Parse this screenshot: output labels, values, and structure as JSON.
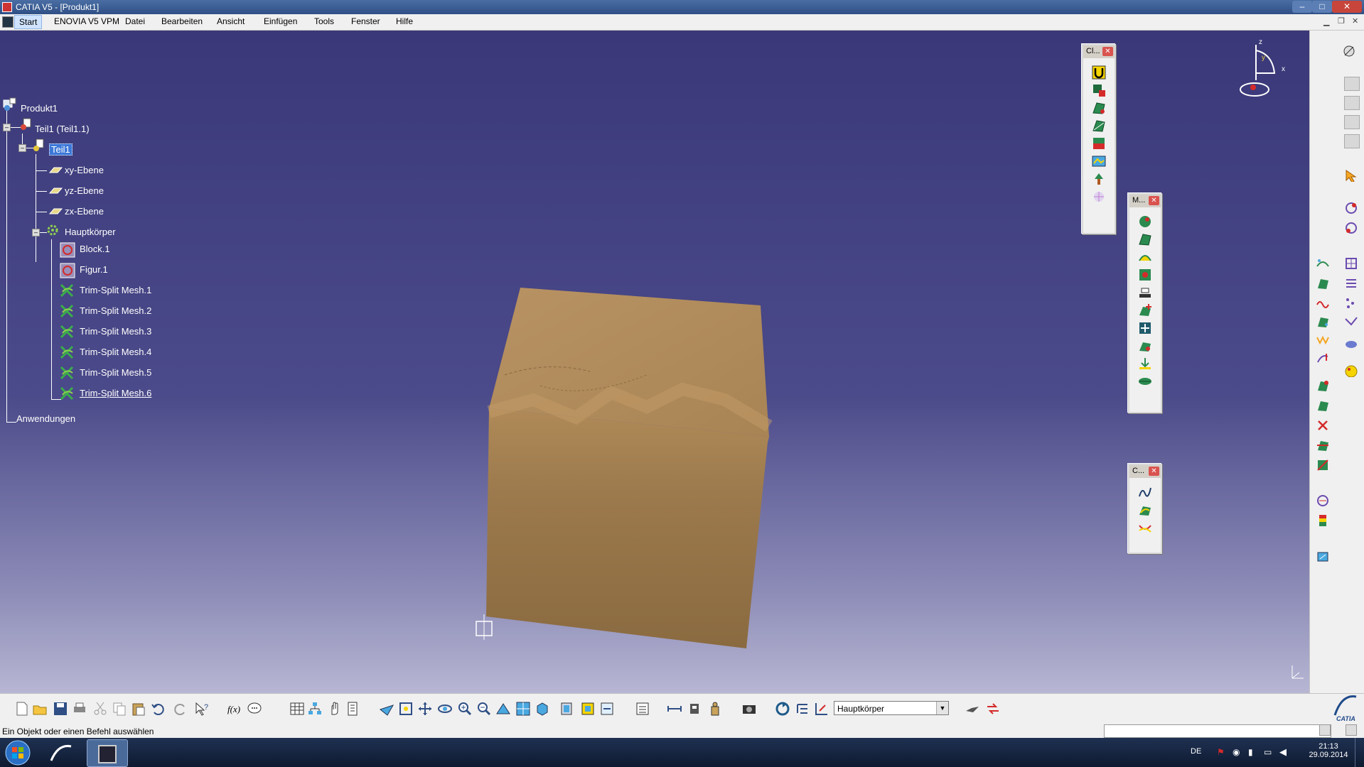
{
  "window": {
    "title": "CATIA V5 - [Produkt1]",
    "controls": [
      "–",
      "□",
      "✕"
    ]
  },
  "menubar": {
    "items": [
      "Start",
      "ENOVIA V5 VPM",
      "Datei",
      "Bearbeiten",
      "Ansicht",
      "Einfügen",
      "Tools",
      "Fenster",
      "Hilfe"
    ]
  },
  "tree": {
    "root": "Produkt1",
    "part_instance": "Teil1 (Teil1.1)",
    "part": "Teil1",
    "planes": [
      "xy-Ebene",
      "yz-Ebene",
      "zx-Ebene"
    ],
    "body": "Hauptkörper",
    "features": [
      "Block.1",
      "Figur.1",
      "Trim-Split Mesh.1",
      "Trim-Split Mesh.2",
      "Trim-Split Mesh.3",
      "Trim-Split Mesh.4",
      "Trim-Split Mesh.5",
      "Trim-Split Mesh.6"
    ],
    "applications": "Anwendungen"
  },
  "floating_toolbars": [
    {
      "title": "Cl...",
      "icon_count": 8
    },
    {
      "title": "M...",
      "icon_count": 10
    },
    {
      "title": "C...",
      "icon_count": 3
    }
  ],
  "compass": {
    "axes": [
      "z",
      "y",
      "x"
    ]
  },
  "body_selector": {
    "value": "Hauptkörper"
  },
  "statusbar": {
    "message": "Ein Objekt oder einen Befehl auswählen"
  },
  "taskbar": {
    "language": "DE",
    "time": "21:13",
    "date": "29.09.2014"
  },
  "colors": {
    "viewport_top": "#3a3878",
    "viewport_bottom": "#b7b6d3",
    "model": "#a07e4f",
    "selection": "#3c78d8"
  }
}
